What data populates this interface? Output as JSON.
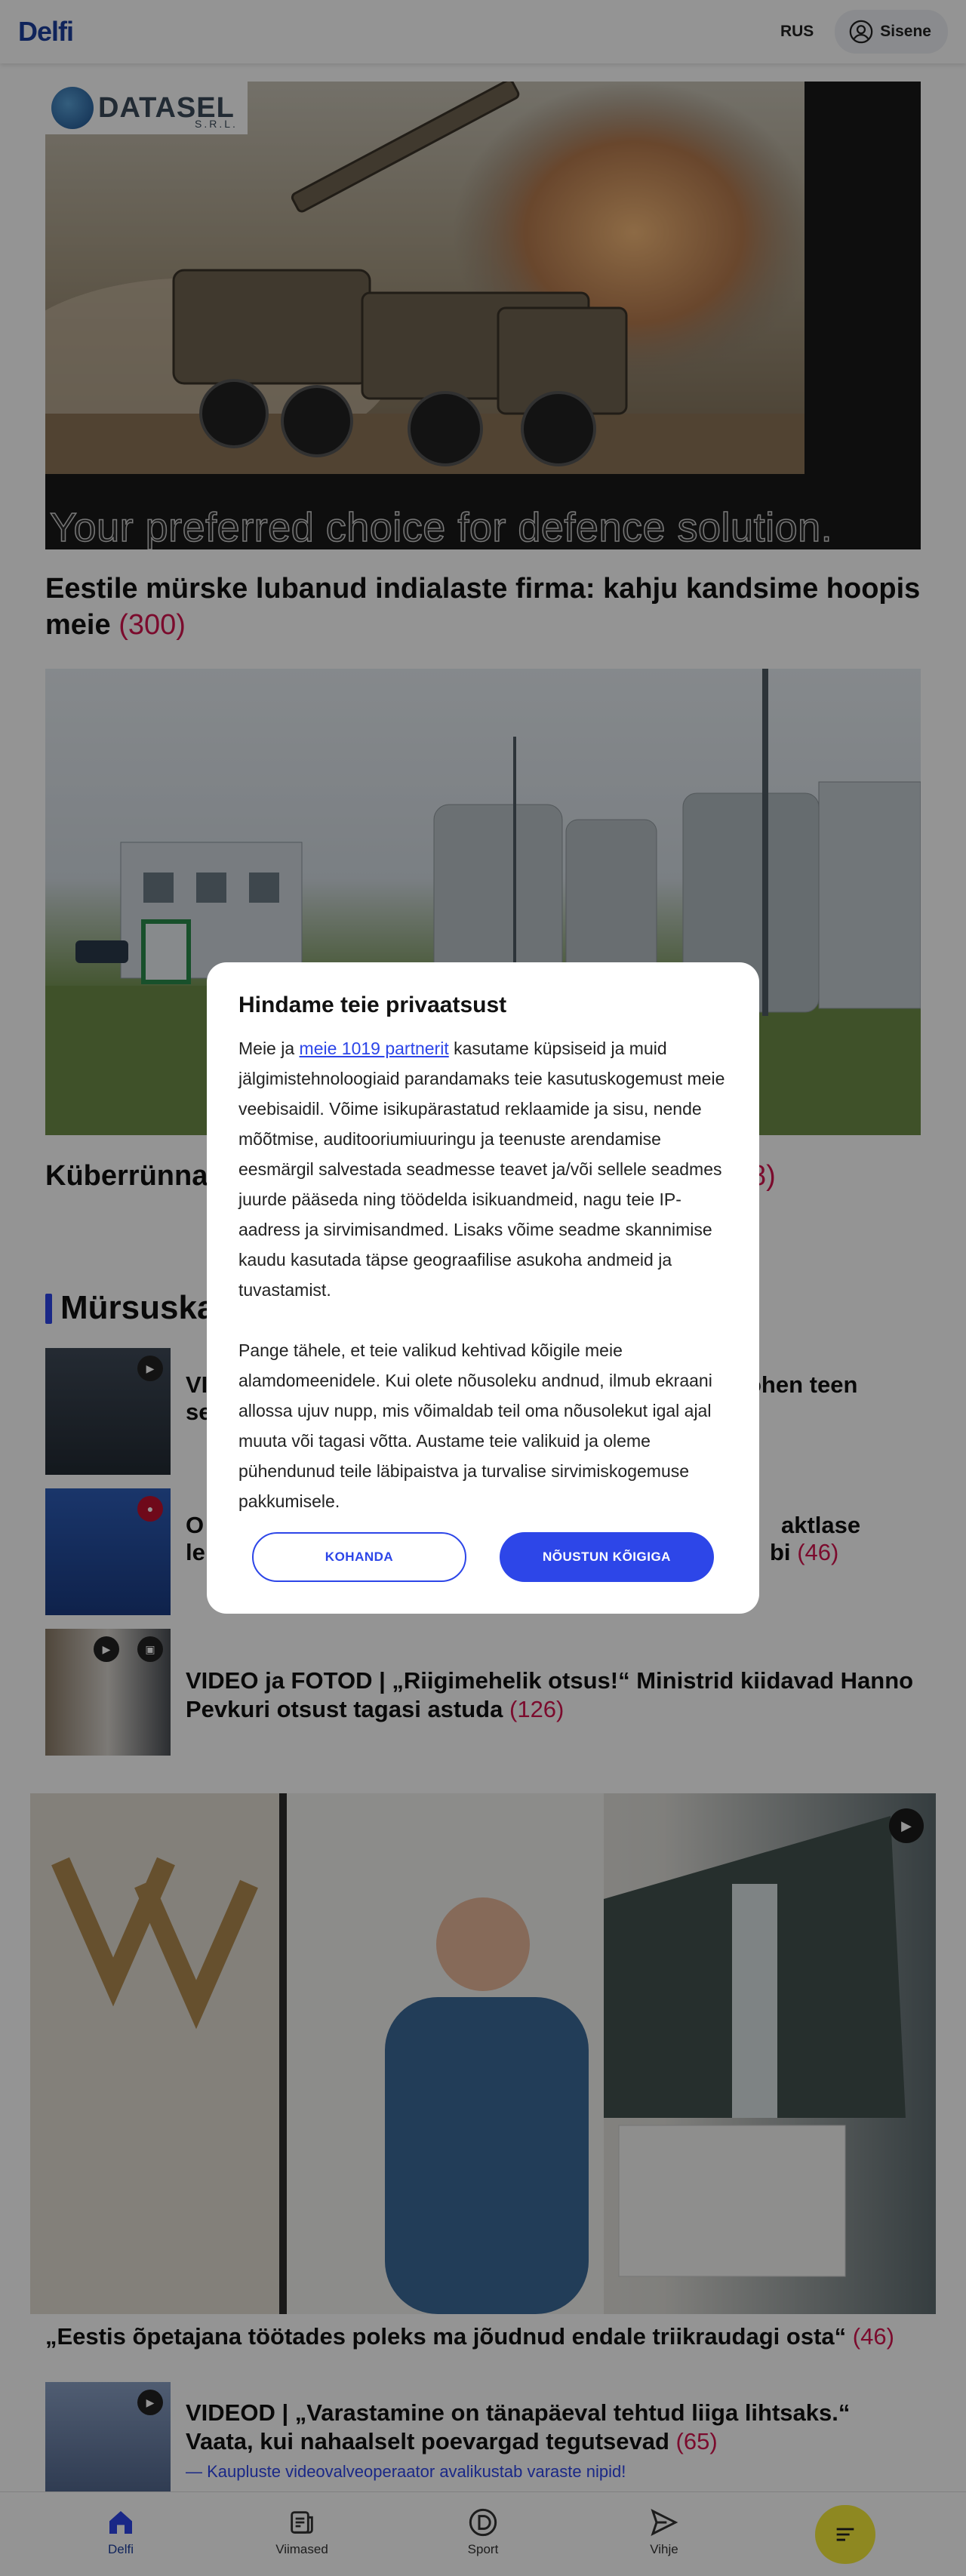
{
  "header": {
    "logo": "Delfi",
    "lang": "RUS",
    "signin": "Sisene"
  },
  "ad": {
    "brand": "DATASEL",
    "brand_sub": "S.R.L.",
    "slogan": "Your preferred choice for defence solution."
  },
  "articles": [
    {
      "title": "Eestile mürske lubanud indialaste firma: kahju kandsime hoopis meie",
      "count": "(300)"
    },
    {
      "title": "Küberrünnak",
      "count": "8)"
    }
  ],
  "section": {
    "title": "Mürsuska"
  },
  "news": [
    {
      "title": "VI",
      "title_right": "öhen teen",
      "title2": "se",
      "count": ""
    },
    {
      "title": "O",
      "title_right": "aktlase",
      "title2": "le",
      "title2_right": "bi",
      "count": "(46)"
    },
    {
      "title": "VIDEO ja FOTOD | „Riigimehelik otsus!“ Ministrid kiidavad Hanno Pevkuri otsust tagasi astuda",
      "count": "(126)"
    }
  ],
  "big_article": {
    "title": "„Eestis õpetajana töötades poleks ma jõudnud endale triikraudagi osta“",
    "count": "(46)"
  },
  "last_article": {
    "title": "VIDEOD | „Varastamine on tänapäeval tehtud liiga lihtsaks.“ Vaata, kui nahaalselt poevargad tegutsevad",
    "count": "(65)",
    "sub": "— Kaupluste videovalveoperaator avalikustab varaste nipid!"
  },
  "bottom_nav": {
    "items": [
      {
        "label": "Delfi",
        "icon": "home-icon"
      },
      {
        "label": "Viimased",
        "icon": "latest-icon"
      },
      {
        "label": "Sport",
        "icon": "sport-icon"
      },
      {
        "label": "Vihje",
        "icon": "send-icon"
      }
    ],
    "menu_icon": "menu-icon"
  },
  "modal": {
    "title": "Hindame teie privaatsust",
    "p1_before": "Meie ja ",
    "p1_link": "meie 1019 partnerit",
    "p1_after": " kasutame küpsiseid ja muid jälgimistehnoloogiaid parandamaks teie kasutuskogemust meie veebisaidil. Võime isikupärastatud reklaamide ja sisu, nende mõõtmise, auditooriumiuuringu ja teenuste arendamise eesmärgil salvestada seadmesse teavet ja/või sellele seadmes juurde pääseda ning töödelda isikuandmeid, nagu teie IP-aadress ja sirvimisandmed. Lisaks võime seadme skannimise kaudu kasutada täpse geograafilise asukoha andmeid ja tuvastamist.",
    "p2": "Pange tähele, et teie valikud kehtivad kõigile meie alamdomeenidele. Kui olete nõusoleku andnud, ilmub ekraani allossa ujuv nupp, mis võimaldab teil oma nõusolekut igal ajal muuta või tagasi võtta. Austame teie valikuid ja oleme pühendunud teile läbipaistva ja turvalise sirvimiskogemuse pakkumisele.",
    "btn_customize": "KOHANDA",
    "btn_accept": "NÕUSTUN KÕIGIGA"
  }
}
